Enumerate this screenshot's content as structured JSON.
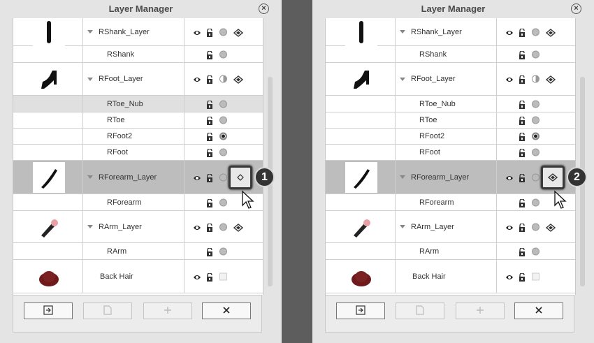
{
  "panels": [
    {
      "title": "Layer Manager",
      "step_label": "1",
      "rows": [
        {
          "name": "RShank_Layer",
          "kind": "parent",
          "thumb": "shank-icon",
          "dot": "grey",
          "sym": "show-icon"
        },
        {
          "name": "RShank",
          "kind": "child",
          "dot": "grey"
        },
        {
          "name": "RFoot_Layer",
          "kind": "parent",
          "thumb": "foot-icon",
          "dot": "half",
          "sym": "show-icon"
        },
        {
          "name": "RToe_Nub",
          "kind": "child",
          "shade": true,
          "dot": "grey"
        },
        {
          "name": "RToe",
          "kind": "child",
          "dot": "grey"
        },
        {
          "name": "RFoot2",
          "kind": "child",
          "dot": "black"
        },
        {
          "name": "RFoot",
          "kind": "child",
          "dot": "grey"
        },
        {
          "name": "RForearm_Layer",
          "kind": "parent",
          "thumb": "forearm-icon",
          "selected": true,
          "dot": "grey",
          "sym": "diamond-icon"
        },
        {
          "name": "RForearm",
          "kind": "child",
          "dot": "grey"
        },
        {
          "name": "RArm_Layer",
          "kind": "parent",
          "thumb": "arm-icon",
          "dot": "grey",
          "sym": "show-icon"
        },
        {
          "name": "RArm",
          "kind": "child",
          "dot": "grey"
        },
        {
          "name": "Back Hair",
          "kind": "noarrow",
          "thumb": "hair-icon",
          "dot": "square"
        }
      ]
    },
    {
      "title": "Layer Manager",
      "step_label": "2",
      "rows": [
        {
          "name": "RShank_Layer",
          "kind": "parent",
          "thumb": "shank-icon",
          "dot": "grey",
          "sym": "show-icon"
        },
        {
          "name": "RShank",
          "kind": "child",
          "dot": "grey"
        },
        {
          "name": "RFoot_Layer",
          "kind": "parent",
          "thumb": "foot-icon",
          "dot": "half",
          "sym": "show-icon"
        },
        {
          "name": "RToe_Nub",
          "kind": "child",
          "dot": "grey"
        },
        {
          "name": "RToe",
          "kind": "child",
          "dot": "grey"
        },
        {
          "name": "RFoot2",
          "kind": "child",
          "dot": "black"
        },
        {
          "name": "RFoot",
          "kind": "child",
          "dot": "grey"
        },
        {
          "name": "RForearm_Layer",
          "kind": "parent",
          "thumb": "forearm-icon",
          "selected": true,
          "dot": "grey",
          "sym": "show-icon"
        },
        {
          "name": "RForearm",
          "kind": "child",
          "dot": "grey"
        },
        {
          "name": "RArm_Layer",
          "kind": "parent",
          "thumb": "arm-icon",
          "dot": "grey",
          "sym": "show-icon"
        },
        {
          "name": "RArm",
          "kind": "child",
          "dot": "grey"
        },
        {
          "name": "Back Hair",
          "kind": "noarrow",
          "thumb": "hair-icon",
          "dot": "square"
        }
      ]
    }
  ],
  "toolbar": [
    {
      "icon": "import-icon",
      "disabled": false
    },
    {
      "icon": "page-icon",
      "disabled": true
    },
    {
      "icon": "plus-icon",
      "disabled": true
    },
    {
      "icon": "close-icon",
      "disabled": false
    }
  ],
  "colors": {
    "selected_row": "#bdbdbd",
    "shaded_row": "#e0e0e0",
    "panel_bg": "#e4e4e4",
    "gutter": "#5d5d5d"
  }
}
